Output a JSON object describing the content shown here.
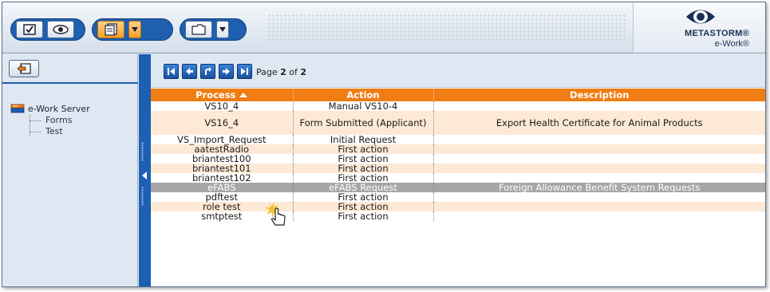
{
  "toolbar": {
    "groups": [
      {
        "buttons": [
          "checkbox-icon",
          "eye-icon"
        ]
      },
      {
        "buttons": [
          "document-stack-icon"
        ],
        "active": true,
        "dropdown": "chevron-down-icon"
      },
      {
        "buttons": [
          "folder-icon"
        ],
        "dropdown": "chevron-down-icon"
      }
    ]
  },
  "logo": {
    "brand": "METASTORM®",
    "product": "e-Work®"
  },
  "sidebar": {
    "back_button_icon": "back-arrow-icon",
    "tree": {
      "root_label": "e-Work Server",
      "root_icon": "server-icon",
      "children": [
        "Forms",
        "Test"
      ]
    }
  },
  "pager": {
    "buttons": [
      "first-page-icon",
      "previous-page-icon",
      "refresh-icon",
      "next-page-icon",
      "last-page-icon"
    ],
    "page_prefix": "Page",
    "current_page": "2",
    "page_sep": "of",
    "total_pages": "2"
  },
  "table": {
    "headers": {
      "process": "Process",
      "action": "Action",
      "description": "Description"
    },
    "rows": [
      {
        "process": "VS10_4",
        "action": "Manual VS10-4",
        "description": ""
      },
      {
        "process": "VS16_4",
        "action": "Form Submitted (Applicant)",
        "description": "Export Health Certificate for Animal Products"
      },
      {
        "process": "VS_Import_Request",
        "action": "Initial Request",
        "description": ""
      },
      {
        "process": "aatestRadio",
        "action": "First action",
        "description": ""
      },
      {
        "process": "briantest100",
        "action": "First action",
        "description": ""
      },
      {
        "process": "briantest101",
        "action": "First action",
        "description": ""
      },
      {
        "process": "briantest102",
        "action": "First action",
        "description": ""
      },
      {
        "process": "eFABS",
        "action": "eFABS Request",
        "description": "Foreign Allowance Benefit System Requests"
      },
      {
        "process": "pdftest",
        "action": "First action",
        "description": ""
      },
      {
        "process": "role test",
        "action": "First action",
        "description": ""
      },
      {
        "process": "smtptest",
        "action": "First action",
        "description": ""
      }
    ]
  },
  "colors": {
    "header_orange": "#ef7d14",
    "alt_row": "#fde9d6",
    "selected_row": "#a6a6a6",
    "accent_blue": "#1d5fb3"
  }
}
